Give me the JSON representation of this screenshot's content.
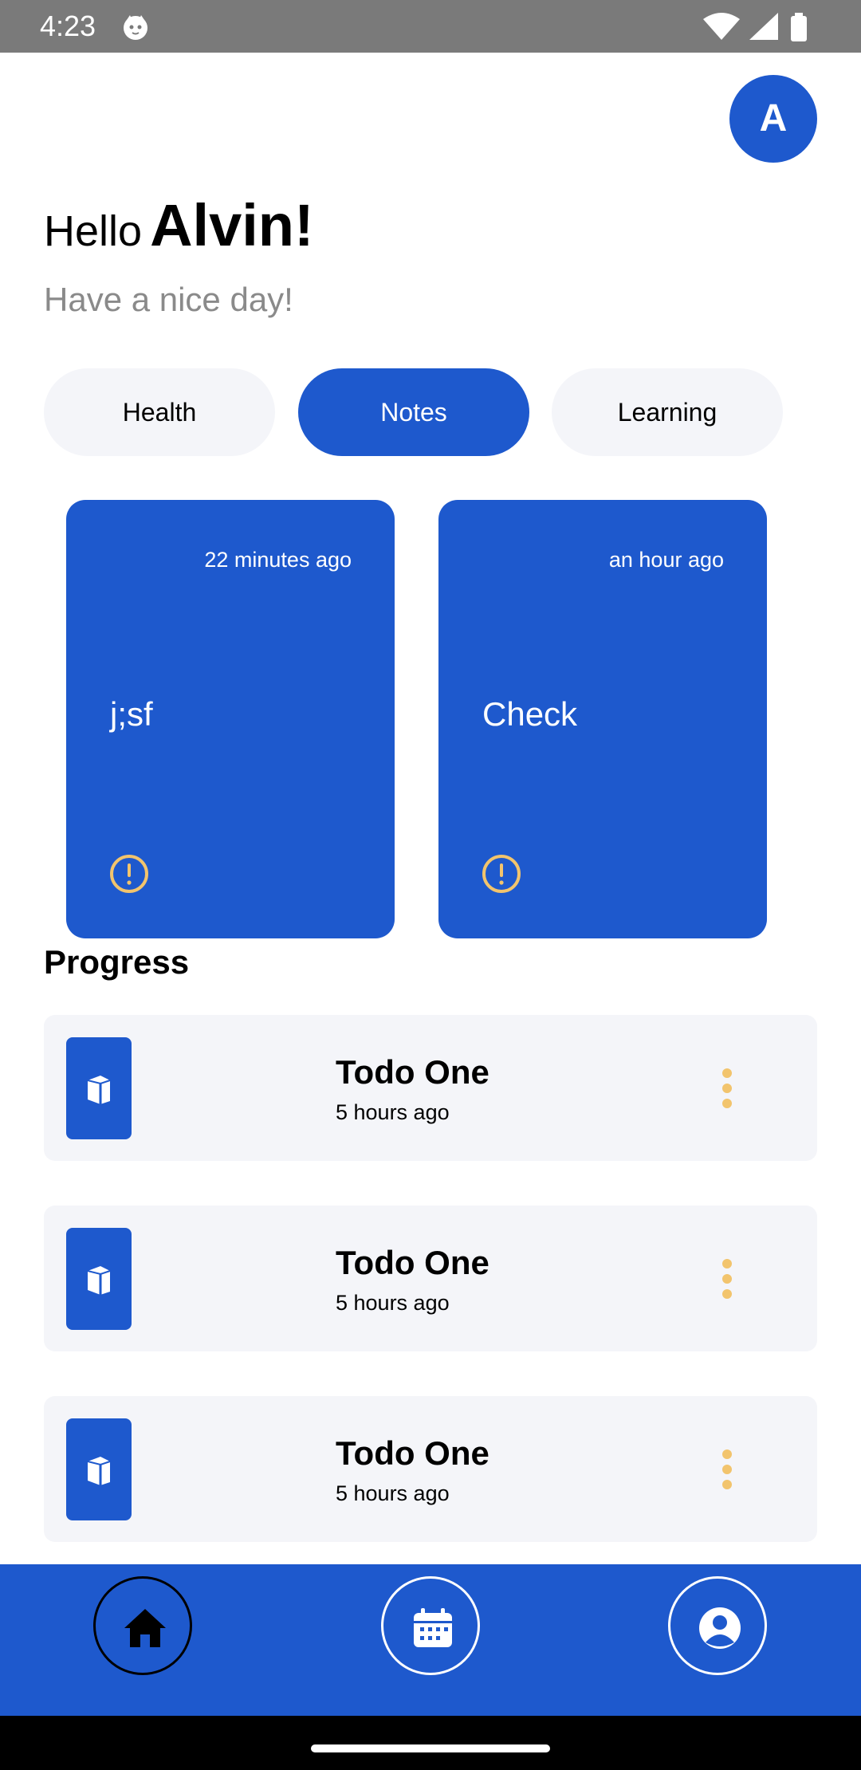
{
  "status_bar": {
    "time": "4:23",
    "icons": [
      "cat-notification-icon",
      "wifi-icon",
      "signal-icon",
      "battery-icon"
    ]
  },
  "avatar": {
    "letter": "A",
    "color": "#1e59cd"
  },
  "greeting": {
    "hello": "Hello",
    "name": "Alvin!",
    "subtitle": "Have a nice day!"
  },
  "categories": [
    {
      "label": "Health",
      "active": false
    },
    {
      "label": "Notes",
      "active": true
    },
    {
      "label": "Learning",
      "active": false
    }
  ],
  "notes": [
    {
      "time": "22 minutes ago",
      "title": "j;sf",
      "icon": "alert-circle-icon"
    },
    {
      "time": "an hour ago",
      "title": "Check",
      "icon": "alert-circle-icon"
    }
  ],
  "progress": {
    "heading": "Progress",
    "items": [
      {
        "title": "Todo One",
        "time": "5 hours ago",
        "icon": "book-icon",
        "menu_icon": "more-vertical-icon"
      },
      {
        "title": "Todo One",
        "time": "5 hours ago",
        "icon": "book-icon",
        "menu_icon": "more-vertical-icon"
      },
      {
        "title": "Todo One",
        "time": "5 hours ago",
        "icon": "book-icon",
        "menu_icon": "more-vertical-icon"
      }
    ]
  },
  "bottom_nav": {
    "items": [
      {
        "icon": "home-icon",
        "active": true
      },
      {
        "icon": "calendar-icon",
        "active": false
      },
      {
        "icon": "profile-icon",
        "active": false
      }
    ]
  },
  "colors": {
    "primary": "#1e59cd",
    "chip_bg": "#f4f5f9",
    "accent": "#f2c46d",
    "muted_text": "#8a8a8a"
  }
}
